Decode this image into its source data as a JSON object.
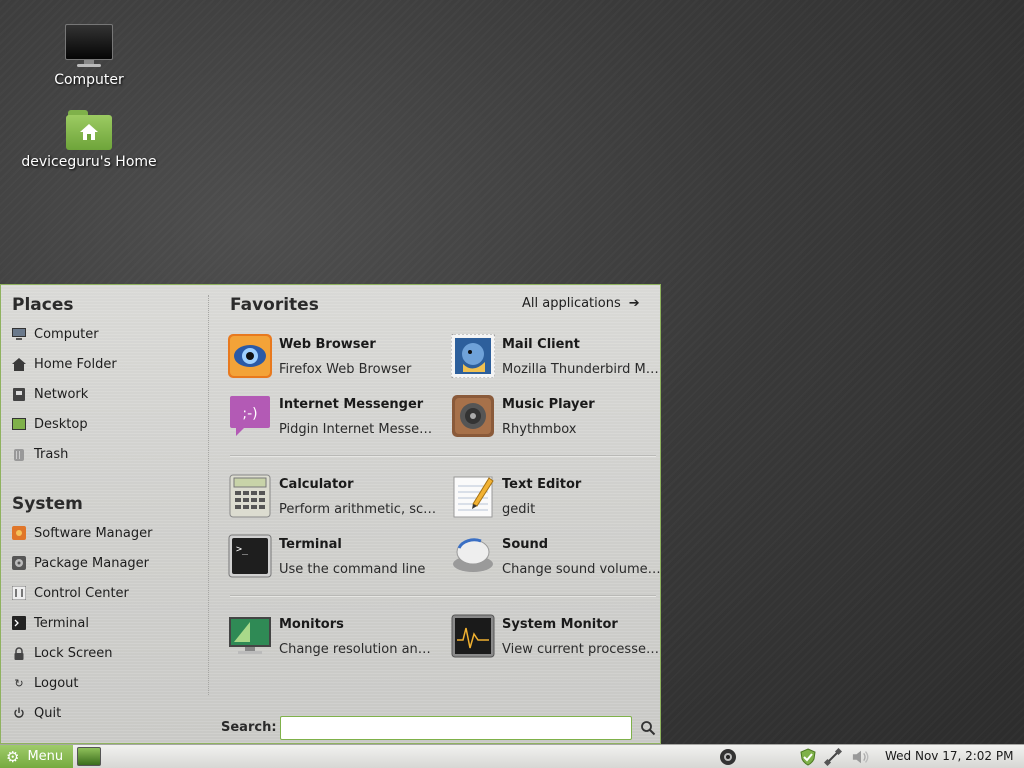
{
  "desktop": {
    "icons": [
      {
        "label": "Computer",
        "icon": "computer-monitor-icon"
      },
      {
        "label": "deviceguru's Home",
        "icon": "home-folder-icon"
      }
    ]
  },
  "menu": {
    "places": {
      "title": "Places",
      "items": [
        {
          "label": "Computer",
          "icon": "computer-icon"
        },
        {
          "label": "Home Folder",
          "icon": "home-icon"
        },
        {
          "label": "Network",
          "icon": "network-icon"
        },
        {
          "label": "Desktop",
          "icon": "desktop-icon"
        },
        {
          "label": "Trash",
          "icon": "trash-icon"
        }
      ]
    },
    "system": {
      "title": "System",
      "items": [
        {
          "label": "Software Manager",
          "icon": "software-manager-icon"
        },
        {
          "label": "Package Manager",
          "icon": "package-manager-icon"
        },
        {
          "label": "Control Center",
          "icon": "control-center-icon"
        },
        {
          "label": "Terminal",
          "icon": "terminal-icon"
        },
        {
          "label": "Lock Screen",
          "icon": "lock-icon"
        },
        {
          "label": "Logout",
          "icon": "logout-icon"
        },
        {
          "label": "Quit",
          "icon": "power-icon"
        }
      ]
    },
    "favorites": {
      "title": "Favorites",
      "all_applications": "All applications",
      "items": [
        {
          "name": "Web Browser",
          "desc": "Firefox Web Browser",
          "icon": "firefox-icon"
        },
        {
          "name": "Mail Client",
          "desc": "Mozilla Thunderbird Ma...",
          "icon": "thunderbird-icon"
        },
        {
          "name": "Internet Messenger",
          "desc": "Pidgin Internet Messen...",
          "icon": "pidgin-icon"
        },
        {
          "name": "Music Player",
          "desc": "Rhythmbox",
          "icon": "speaker-icon"
        },
        {
          "name": "Calculator",
          "desc": "Perform arithmetic, sci...",
          "icon": "calculator-icon"
        },
        {
          "name": "Text Editor",
          "desc": "gedit",
          "icon": "text-editor-icon"
        },
        {
          "name": "Terminal",
          "desc": "Use the command line",
          "icon": "terminal-app-icon"
        },
        {
          "name": "Sound",
          "desc": "Change sound volume ...",
          "icon": "sound-knob-icon"
        },
        {
          "name": "Monitors",
          "desc": "Change resolution and ...",
          "icon": "monitors-icon"
        },
        {
          "name": "System Monitor",
          "desc": "View current processes...",
          "icon": "system-monitor-icon"
        }
      ]
    },
    "search": {
      "label": "Search:",
      "value": "",
      "placeholder": ""
    }
  },
  "taskbar": {
    "menu_label": "Menu",
    "clock": "Wed Nov 17,  2:02 PM",
    "colors": {
      "accent": "#86b94f",
      "panel": "#e4e4e2"
    }
  }
}
